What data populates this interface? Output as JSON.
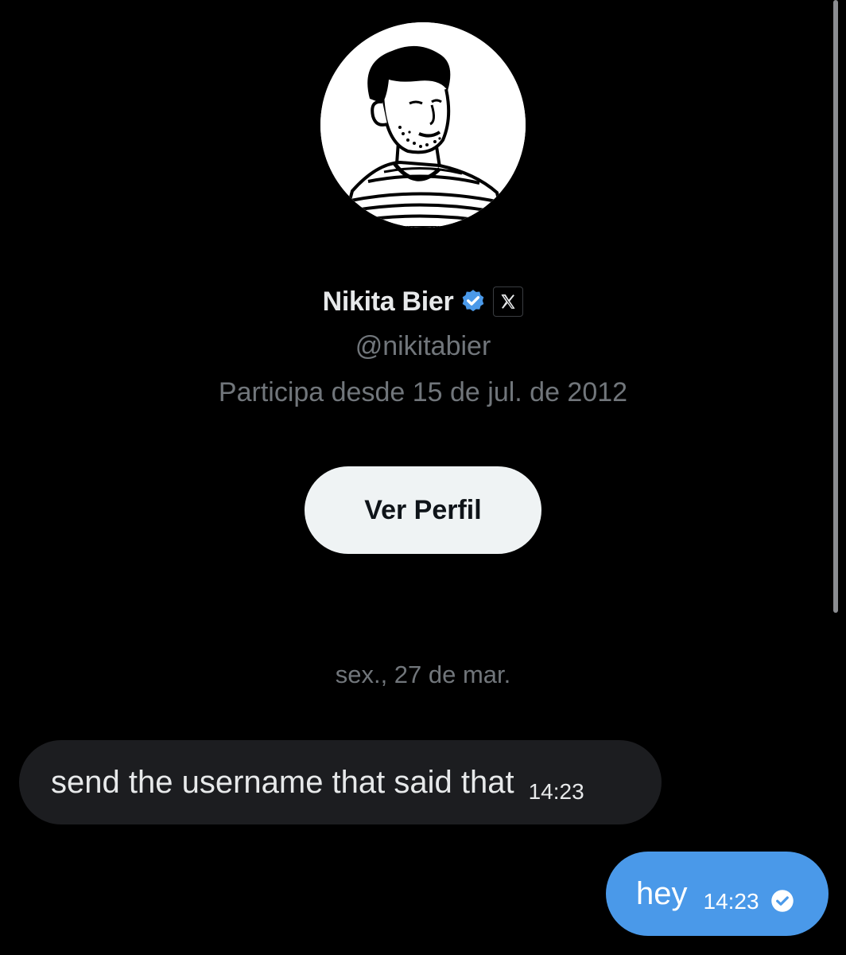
{
  "profile": {
    "name": "Nikita Bier",
    "handle": "@nikitabier",
    "joined": "Participa desde 15 de jul. de 2012",
    "verified_icon": "verified-badge-icon",
    "affiliate_icon": "x-logo-icon",
    "view_profile_label": "Ver Perfil"
  },
  "conversation": {
    "date_separator": "sex., 27 de mar.",
    "messages": [
      {
        "direction": "incoming",
        "text": "send the username that said that",
        "time": "14:23"
      },
      {
        "direction": "outgoing",
        "text": "hey",
        "time": "14:23",
        "status_icon": "read-check-icon"
      }
    ]
  },
  "colors": {
    "background": "#000000",
    "verified": "#4a99e9",
    "outgoing_bubble": "#4a99e9",
    "incoming_bubble": "#1c1d20",
    "secondary_text": "#71767b",
    "button_bg": "#eff3f4"
  }
}
